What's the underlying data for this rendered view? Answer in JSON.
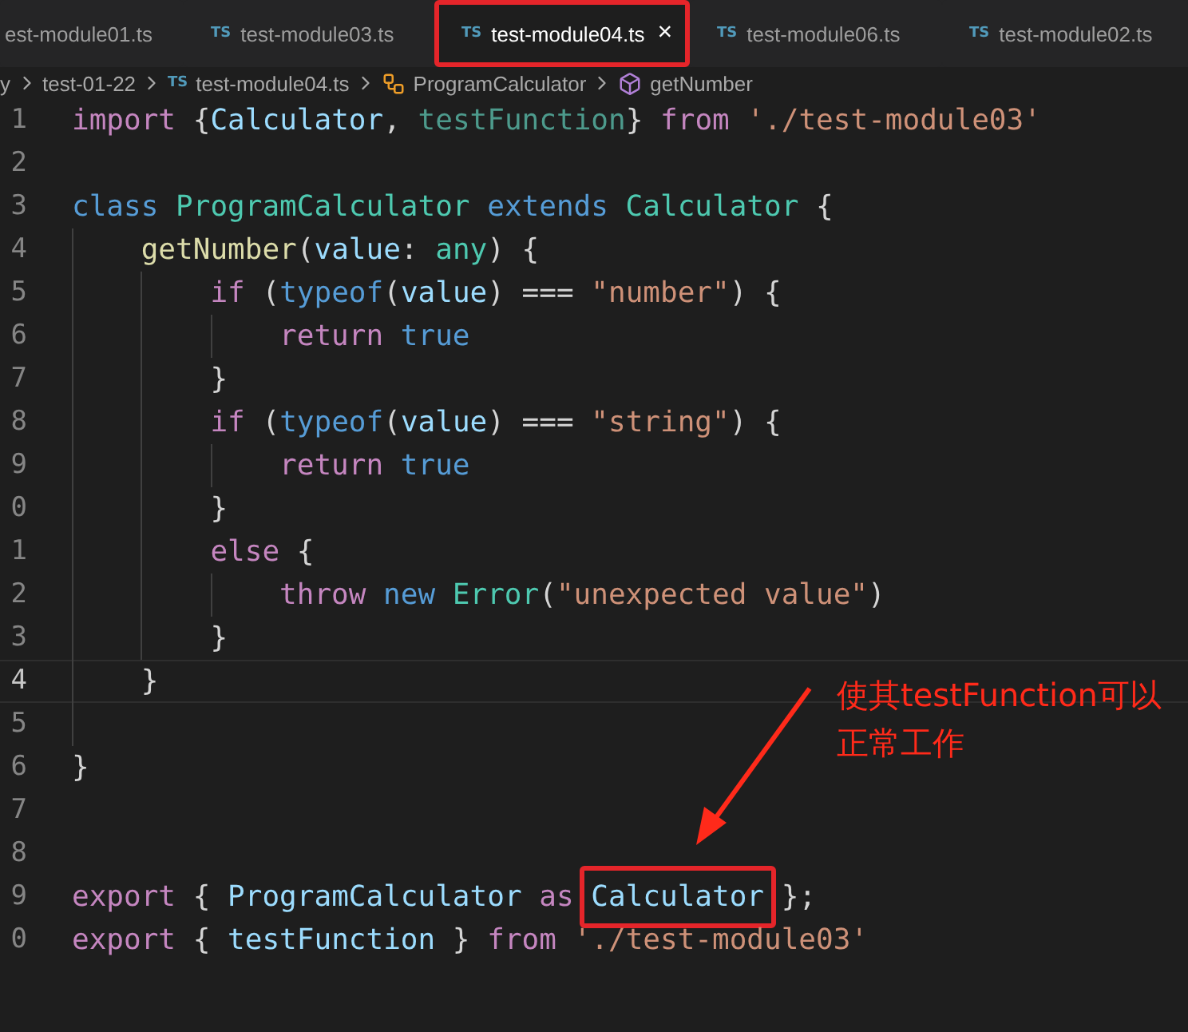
{
  "tabs": [
    {
      "label": "est-module01.ts",
      "selected": false,
      "highlighted": false
    },
    {
      "badge": "TS",
      "label": "test-module03.ts",
      "selected": false,
      "highlighted": false
    },
    {
      "badge": "TS",
      "label": "test-module04.ts",
      "close": "×",
      "selected": true,
      "highlighted": true
    },
    {
      "badge": "TS",
      "label": "test-module06.ts",
      "selected": false,
      "highlighted": false
    },
    {
      "badge": "TS",
      "label": "test-module02.ts",
      "selected": false,
      "highlighted": false
    }
  ],
  "breadcrumb": [
    {
      "kind": "folder",
      "label": "y"
    },
    {
      "kind": "folder",
      "label": "test-01-22"
    },
    {
      "kind": "file",
      "badge": "TS",
      "label": "test-module04.ts"
    },
    {
      "kind": "class",
      "label": "ProgramCalculator"
    },
    {
      "kind": "method",
      "label": "getNumber"
    }
  ],
  "code": [
    {
      "number": "1",
      "tokens": [
        {
          "kind": "keyword",
          "text": "import"
        },
        {
          "kind": "plain",
          "text": " {"
        },
        {
          "kind": "variable",
          "text": "Calculator"
        },
        {
          "kind": "plain",
          "text": ", "
        },
        {
          "kind": "unused",
          "text": "testFunction"
        },
        {
          "kind": "plain",
          "text": "} "
        },
        {
          "kind": "keyword",
          "text": "from"
        },
        {
          "kind": "string",
          "text": " './test-module03'"
        }
      ]
    },
    {
      "number": "2"
    },
    {
      "number": "3",
      "tokens": [
        {
          "kind": "storage",
          "text": "class"
        },
        {
          "kind": "type",
          "text": " ProgramCalculator"
        },
        {
          "kind": "storage",
          "text": " extends"
        },
        {
          "kind": "type",
          "text": " Calculator"
        },
        {
          "kind": "plain",
          "text": " {"
        }
      ],
      "children": [
        {
          "number": "4",
          "tokens": [
            {
              "kind": "function",
              "text": "getNumber"
            },
            {
              "kind": "plain",
              "text": "("
            },
            {
              "kind": "variable",
              "text": "value"
            },
            {
              "kind": "plain",
              "text": ": "
            },
            {
              "kind": "type",
              "text": "any"
            },
            {
              "kind": "plain",
              "text": ") {"
            }
          ],
          "children": [
            {
              "number": "5",
              "tokens": [
                {
                  "kind": "keyword",
                  "text": "if"
                },
                {
                  "kind": "plain",
                  "text": " ("
                },
                {
                  "kind": "storage",
                  "text": "typeof"
                },
                {
                  "kind": "plain",
                  "text": "("
                },
                {
                  "kind": "variable",
                  "text": "value"
                },
                {
                  "kind": "plain",
                  "text": ") === "
                },
                {
                  "kind": "string",
                  "text": "\"number\""
                },
                {
                  "kind": "plain",
                  "text": ") {"
                }
              ],
              "children": [
                {
                  "number": "6",
                  "tokens": [
                    {
                      "kind": "keyword",
                      "text": "return"
                    },
                    {
                      "kind": "storage",
                      "text": " true"
                    }
                  ]
                }
              ]
            },
            {
              "number": "7",
              "tokens": [
                {
                  "kind": "plain",
                  "text": "}"
                }
              ]
            },
            {
              "number": "8",
              "tokens": [
                {
                  "kind": "keyword",
                  "text": "if"
                },
                {
                  "kind": "plain",
                  "text": " ("
                },
                {
                  "kind": "storage",
                  "text": "typeof"
                },
                {
                  "kind": "plain",
                  "text": "("
                },
                {
                  "kind": "variable",
                  "text": "value"
                },
                {
                  "kind": "plain",
                  "text": ") === "
                },
                {
                  "kind": "string",
                  "text": "\"string\""
                },
                {
                  "kind": "plain",
                  "text": ") {"
                }
              ],
              "children": [
                {
                  "number": "9",
                  "tokens": [
                    {
                      "kind": "keyword",
                      "text": "return"
                    },
                    {
                      "kind": "storage",
                      "text": " true"
                    }
                  ]
                }
              ]
            },
            {
              "number": "0",
              "tokens": [
                {
                  "kind": "plain",
                  "text": "}"
                }
              ]
            },
            {
              "number": "1",
              "tokens": [
                {
                  "kind": "keyword",
                  "text": "else"
                },
                {
                  "kind": "plain",
                  "text": " {"
                }
              ],
              "children": [
                {
                  "number": "2",
                  "tokens": [
                    {
                      "kind": "keyword",
                      "text": "throw"
                    },
                    {
                      "kind": "storage",
                      "text": " new"
                    },
                    {
                      "kind": "type",
                      "text": " Error"
                    },
                    {
                      "kind": "plain",
                      "text": "("
                    },
                    {
                      "kind": "string",
                      "text": "\"unexpected value\""
                    },
                    {
                      "kind": "plain",
                      "text": ")"
                    }
                  ]
                }
              ]
            },
            {
              "number": "3",
              "tokens": [
                {
                  "kind": "plain",
                  "text": "}"
                }
              ]
            }
          ]
        },
        {
          "number": "4",
          "current": true,
          "tokens": [
            {
              "kind": "plain",
              "text": "}"
            }
          ]
        },
        {
          "number": "5"
        }
      ]
    },
    {
      "number": "6",
      "tokens": [
        {
          "kind": "plain",
          "text": "}"
        }
      ]
    },
    {
      "number": "7"
    },
    {
      "number": "8"
    },
    {
      "number": "9",
      "tokens": [
        {
          "kind": "keyword",
          "text": "export"
        },
        {
          "kind": "plain",
          "text": " { "
        },
        {
          "kind": "variable",
          "text": "ProgramCalculator"
        },
        {
          "kind": "keyword",
          "text": " as "
        },
        {
          "kind": "variable",
          "text": "Calculator",
          "highlighted": true
        },
        {
          "kind": "plain",
          "text": " };"
        }
      ]
    },
    {
      "number": "0",
      "tokens": [
        {
          "kind": "keyword",
          "text": "export"
        },
        {
          "kind": "plain",
          "text": " { "
        },
        {
          "kind": "variable",
          "text": "testFunction"
        },
        {
          "kind": "plain",
          "text": " } "
        },
        {
          "kind": "keyword",
          "text": "from"
        },
        {
          "kind": "string",
          "text": " './test-module03'"
        }
      ]
    }
  ],
  "annotation": {
    "text": "使其testFunction可以正常工作"
  }
}
